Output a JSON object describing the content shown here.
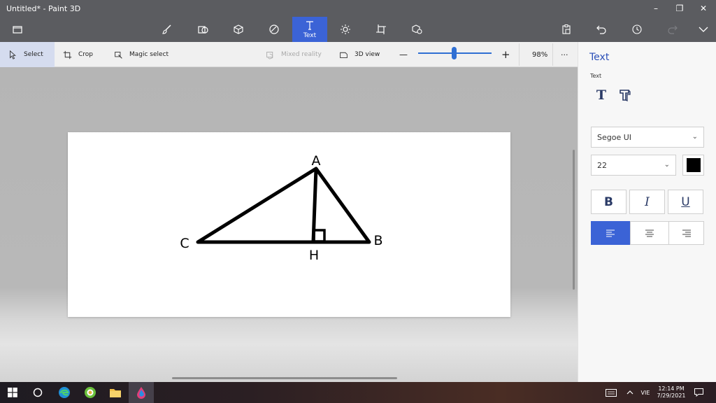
{
  "window": {
    "title": "Untitled* - Paint 3D",
    "controls": {
      "minimize": "–",
      "restore": "❐",
      "close": "✕"
    }
  },
  "toolbar": {
    "menu_icon": "folder-icon",
    "tools": [
      {
        "name": "brushes",
        "icon": "brush-icon"
      },
      {
        "name": "2d-shapes",
        "icon": "2d-shapes-icon"
      },
      {
        "name": "3d-shapes",
        "icon": "3d-cube-icon"
      },
      {
        "name": "stickers",
        "icon": "sticker-icon"
      },
      {
        "name": "text",
        "icon": "text-icon",
        "label": "Text",
        "active": true
      },
      {
        "name": "effects",
        "icon": "sun-icon"
      },
      {
        "name": "canvas",
        "icon": "crop-canvas-icon"
      },
      {
        "name": "3d-library",
        "icon": "3d-library-icon"
      }
    ],
    "right_icons": [
      "paste-icon",
      "undo-icon",
      "history-icon",
      "redo-icon",
      "expand-chevron-icon"
    ]
  },
  "subtoolbar": {
    "select_label": "Select",
    "crop_label": "Crop",
    "magic_select_label": "Magic select",
    "mixed_reality_label": "Mixed reality",
    "view3d_label": "3D view",
    "zoom_minus": "—",
    "zoom_plus": "+",
    "zoom_level": "98%",
    "zoom_fraction": 0.5,
    "more": "···"
  },
  "canvas": {
    "labels": {
      "A": "A",
      "B": "B",
      "C": "C",
      "H": "H"
    }
  },
  "panel": {
    "title": "Text",
    "subtitle": "Text",
    "font_name": "Segoe UI",
    "font_size": "22",
    "text_color": "#000000",
    "bold_label": "B",
    "italic_label": "I",
    "underline_label": "U",
    "alignment": "left"
  },
  "taskbar": {
    "language": "VIE",
    "time": "12:14 PM",
    "date": "7/29/2021"
  },
  "colors": {
    "accent": "#3b63d6",
    "title_bar": "#5b5c60"
  }
}
